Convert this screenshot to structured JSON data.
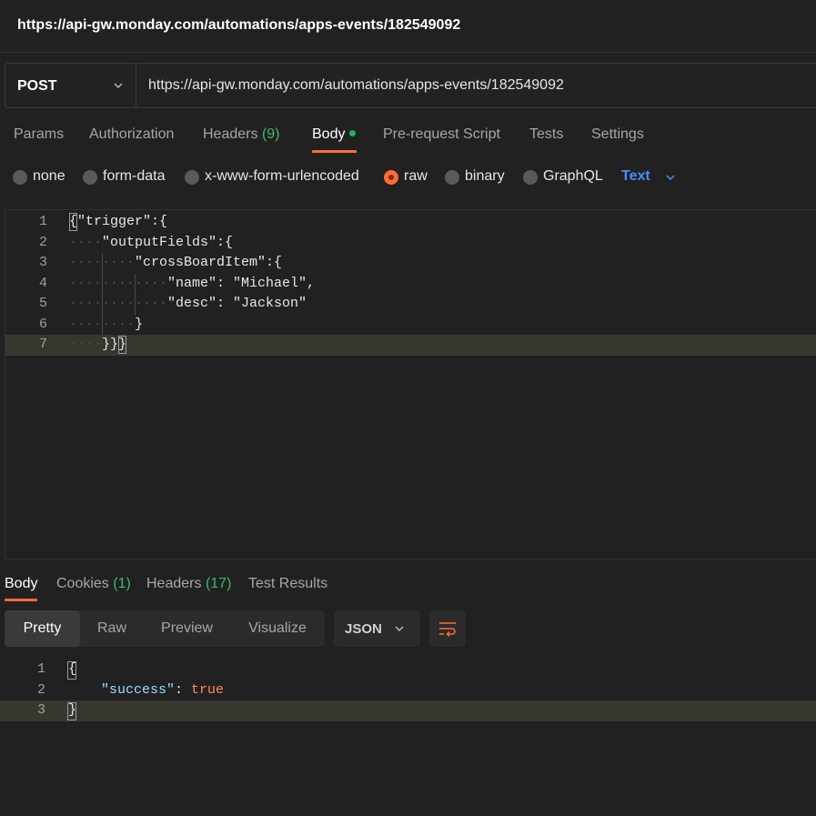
{
  "window": {
    "title": "https://api-gw.monday.com/automations/apps-events/182549092"
  },
  "request": {
    "method": "POST",
    "url": "https://api-gw.monday.com/automations/apps-events/182549092"
  },
  "request_tabs": [
    {
      "label": "Params"
    },
    {
      "label": "Authorization"
    },
    {
      "label": "Headers",
      "count": "(9)"
    },
    {
      "label": "Body",
      "active": true
    },
    {
      "label": "Pre-request Script"
    },
    {
      "label": "Tests"
    },
    {
      "label": "Settings"
    }
  ],
  "body_types": {
    "options": [
      "none",
      "form-data",
      "x-www-form-urlencoded",
      "raw",
      "binary",
      "GraphQL"
    ],
    "selected": "raw",
    "format": "Text"
  },
  "request_body": {
    "lines": [
      {
        "num": "1",
        "text": "{\"trigger\":{"
      },
      {
        "num": "2",
        "text": "\"outputFields\":{"
      },
      {
        "num": "3",
        "text": "\"crossBoardItem\":{"
      },
      {
        "num": "4",
        "text": "\"name\": \"Michael\","
      },
      {
        "num": "5",
        "text": "\"desc\": \"Jackson\""
      },
      {
        "num": "6",
        "text": "}"
      },
      {
        "num": "7",
        "text": "}}}"
      }
    ]
  },
  "response_tabs": [
    {
      "label": "Body",
      "active": true
    },
    {
      "label": "Cookies",
      "count": "(1)"
    },
    {
      "label": "Headers",
      "count": "(17)"
    },
    {
      "label": "Test Results"
    }
  ],
  "response_view": {
    "modes": [
      "Pretty",
      "Raw",
      "Preview",
      "Visualize"
    ],
    "active_mode": "Pretty",
    "format": "JSON",
    "wrap_icon": "wrap-lines-icon"
  },
  "response_body": {
    "lines": [
      {
        "num": "1",
        "text": "{"
      },
      {
        "num": "2",
        "key": "\"success\"",
        "sep": ": ",
        "value": "true"
      },
      {
        "num": "3",
        "text": "}"
      }
    ]
  },
  "colors": {
    "accent": "#ff6c37",
    "count_green": "#3fb86e",
    "link_blue": "#4b8df8",
    "background": "#212121"
  }
}
